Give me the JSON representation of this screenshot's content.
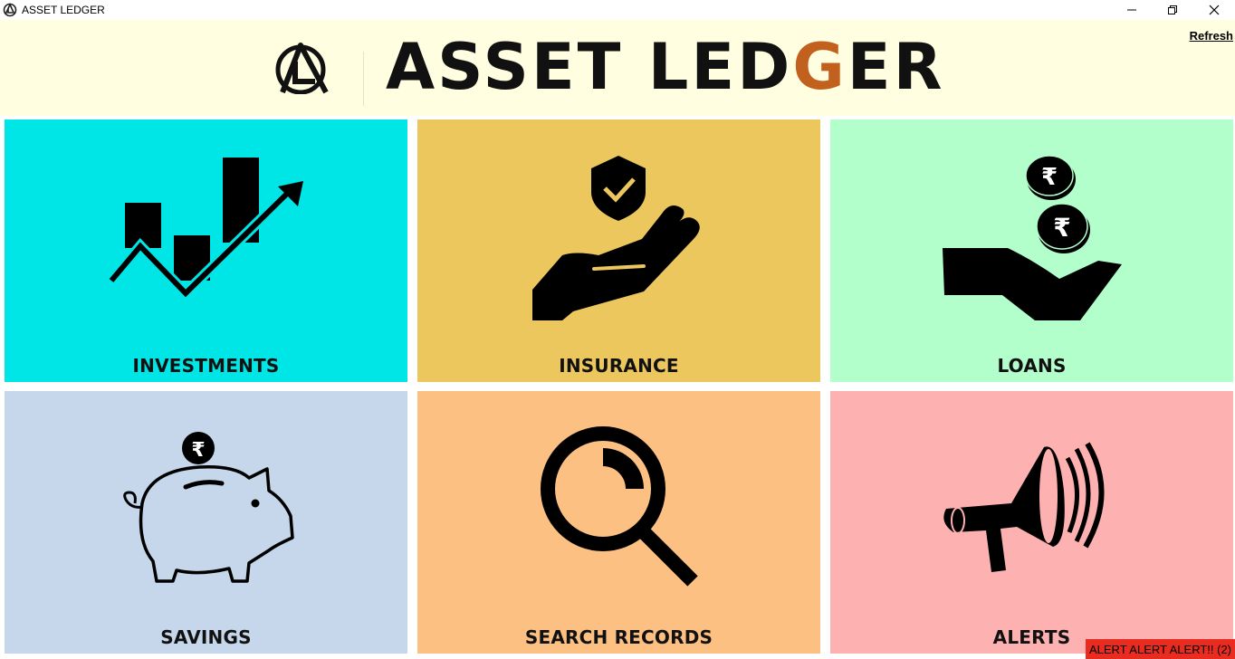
{
  "window": {
    "title": "ASSET LEDGER",
    "icon": "asset-ledger-logo-icon",
    "controls": [
      "minimize",
      "maximize",
      "close"
    ]
  },
  "header": {
    "brand_main": "ASSET LED",
    "brand_g": "G",
    "brand_tail": "ER",
    "refresh_label": "Refresh",
    "accent_color": "#c2611d",
    "background": "#fffee0"
  },
  "tiles": [
    {
      "label": "INVESTMENTS",
      "icon": "growth-chart-icon",
      "color": "#00e5e5"
    },
    {
      "label": "INSURANCE",
      "icon": "hand-shield-icon",
      "color": "#ecc75d"
    },
    {
      "label": "LOANS",
      "icon": "hand-coins-icon",
      "color": "#b3ffcc"
    },
    {
      "label": "SAVINGS",
      "icon": "piggy-bank-icon",
      "color": "#c6d7eb"
    },
    {
      "label": "SEARCH RECORDS",
      "icon": "magnifier-icon",
      "color": "#fdc083"
    },
    {
      "label": "ALERTS",
      "icon": "megaphone-icon",
      "color": "#feb1b1"
    }
  ],
  "alert_banner": {
    "text": "ALERT ALERT ALERT!! (2)",
    "color": "#ea2b1f"
  }
}
